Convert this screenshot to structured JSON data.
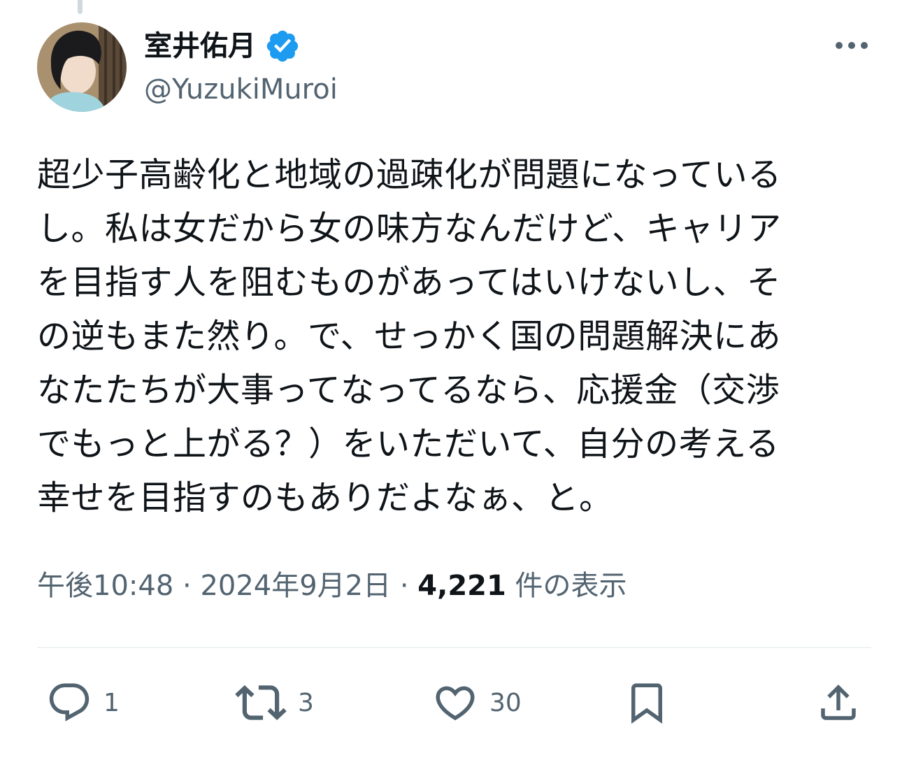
{
  "author": {
    "display_name": "室井佑月",
    "handle": "@YuzukiMuroi",
    "verified": true,
    "verified_color": "#1d9bf0"
  },
  "tweet": {
    "text": "超少子高齢化と地域の過疎化が問題になっている\nし。私は女だから女の味方なんだけど、キャリア\nを目指す人を阻むものがあってはいけないし、そ\nの逆もまた然り。で、せっかく国の問題解決にあ\nなたたちが大事ってなってるなら、応援金（交渉\nでもっと上がる？）をいただいて、自分の考える\n幸せを目指すのもありだよなぁ、と。"
  },
  "meta": {
    "time": "午後10:48",
    "separator": "·",
    "date": "2024年9月2日",
    "views_count": "4,221",
    "views_label": "件の表示"
  },
  "actions": {
    "reply_count": "1",
    "retweet_count": "3",
    "like_count": "30"
  },
  "icons": {
    "reply": "reply-icon",
    "retweet": "retweet-icon",
    "like": "heart-icon",
    "bookmark": "bookmark-icon",
    "share": "share-icon",
    "more": "more-icon",
    "verified": "verified-badge-icon"
  },
  "colors": {
    "text_primary": "#0f1419",
    "text_secondary": "#536471",
    "divider": "#eff3f4"
  }
}
